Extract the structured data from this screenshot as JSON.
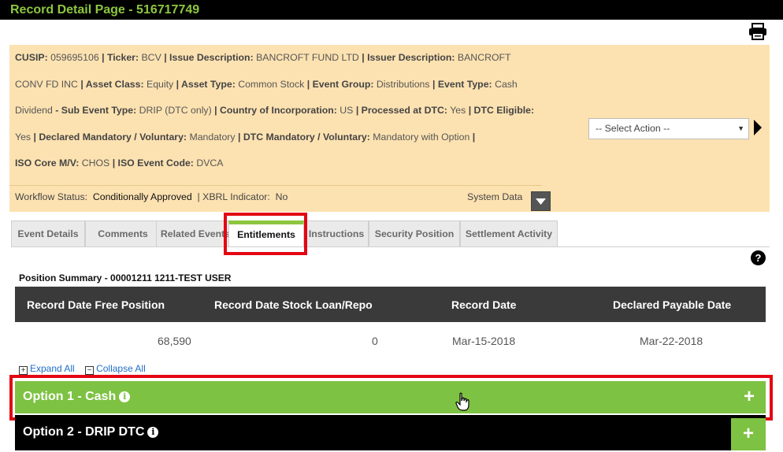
{
  "window": {
    "title": "Record Detail Page - 516717749"
  },
  "event_info": {
    "lines": [
      [
        {
          "k": "CUSIP:",
          "v": "059695106"
        },
        {
          "k": "| Ticker:",
          "v": "BCV"
        },
        {
          "k": "| Issue Description:",
          "v": "BANCROFT FUND LTD"
        },
        {
          "k": "| Issuer Description:",
          "v": "BANCROFT"
        }
      ],
      [
        {
          "k": "",
          "v": "CONV FD INC"
        },
        {
          "k": "| Asset Class:",
          "v": "Equity"
        },
        {
          "k": "| Asset Type:",
          "v": "Common Stock"
        },
        {
          "k": "| Event Group:",
          "v": "Distributions"
        },
        {
          "k": "| Event Type:",
          "v": "Cash"
        }
      ],
      [
        {
          "k": "",
          "v": "Dividend"
        },
        {
          "k": "- Sub Event Type:",
          "v": "DRIP (DTC only)"
        },
        {
          "k": "| Country of Incorporation:",
          "v": "US"
        },
        {
          "k": "| Processed at DTC:",
          "v": "Yes"
        },
        {
          "k": "| DTC Eligible:",
          "v": ""
        }
      ],
      [
        {
          "k": "",
          "v": "Yes"
        },
        {
          "k": "| Declared Mandatory / Voluntary:",
          "v": "Mandatory"
        },
        {
          "k": "| DTC Mandatory / Voluntary:",
          "v": "Mandatory with Option"
        },
        {
          "k": "|",
          "v": ""
        }
      ],
      [
        {
          "k": "ISO Core M/V:",
          "v": "CHOS"
        },
        {
          "k": "| ISO Event Code:",
          "v": "DVCA"
        }
      ]
    ],
    "workflow_label": "Workflow Status:",
    "workflow_value": "Conditionally Approved",
    "xbrl_label": "|  XBRL Indicator:",
    "xbrl_value": "No",
    "system_data_label": "System Data"
  },
  "actions": {
    "select_placeholder": "-- Select Action --"
  },
  "tabs": [
    {
      "label": "Event Details",
      "active": false
    },
    {
      "label": "Comments",
      "active": false
    },
    {
      "label": "Related Events",
      "active": false
    },
    {
      "label": "Entitlements",
      "active": true
    },
    {
      "label": "Instructions",
      "active": false
    },
    {
      "label": "Security Position",
      "active": false
    },
    {
      "label": "Settlement Activity",
      "active": false
    }
  ],
  "position_summary": {
    "title": "Position Summary - 00001211 1211-TEST USER",
    "headers": [
      "Record Date Free Position",
      "Record Date Stock Loan/Repo",
      "Record Date",
      "Declared Payable Date"
    ],
    "row": [
      "68,590",
      "0",
      "Mar-15-2018",
      "Mar-22-2018"
    ]
  },
  "controls": {
    "expand_all": "Expand All",
    "collapse_all": "Collapse All"
  },
  "options": [
    {
      "title": "Option 1 - Cash"
    },
    {
      "title": "Option 2 - DRIP DTC"
    }
  ],
  "icons": {
    "print": "print-icon",
    "help": "help-icon",
    "info": "info-icon",
    "plus": "plus-icon"
  },
  "colors": {
    "accent_green": "#7dc242",
    "highlight_red": "#e30613",
    "info_bg": "#fde2b1"
  }
}
